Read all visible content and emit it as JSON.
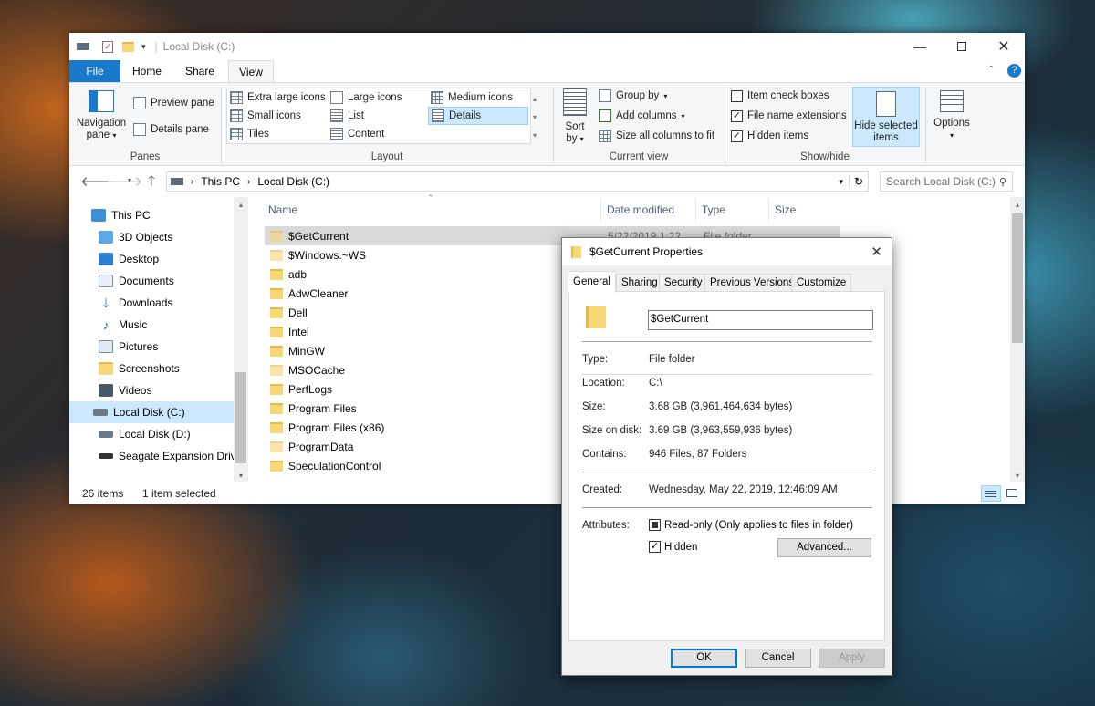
{
  "explorer": {
    "title": "Local Disk (C:)",
    "tabs": {
      "file": "File",
      "home": "Home",
      "share": "Share",
      "view": "View"
    },
    "ribbon": {
      "panes": {
        "navigation_pane": "Navigation",
        "navigation_pane_2": "pane",
        "preview_pane": "Preview pane",
        "details_pane": "Details pane",
        "label": "Panes"
      },
      "layout": {
        "extra_large_icons": "Extra large icons",
        "large_icons": "Large icons",
        "medium_icons": "Medium icons",
        "small_icons": "Small icons",
        "list": "List",
        "details": "Details",
        "tiles": "Tiles",
        "content": "Content",
        "label": "Layout"
      },
      "current_view": {
        "sort_by": "Sort",
        "sort_by_2": "by",
        "group_by": "Group by",
        "add_columns": "Add columns",
        "size_all_columns": "Size all columns to fit",
        "label": "Current view"
      },
      "show_hide": {
        "item_check_boxes": "Item check boxes",
        "file_name_extensions": "File name extensions",
        "hidden_items": "Hidden items",
        "hide_selected_items": "Hide selected",
        "hide_selected_items_2": "items",
        "label": "Show/hide"
      },
      "options": "Options"
    },
    "address": {
      "this_pc": "This PC",
      "drive": "Local Disk (C:)"
    },
    "search_placeholder": "Search Local Disk (C:)",
    "nav_items": [
      "This PC",
      "3D Objects",
      "Desktop",
      "Documents",
      "Downloads",
      "Music",
      "Pictures",
      "Screenshots",
      "Videos",
      "Local Disk (C:)",
      "Local Disk (D:)",
      "Seagate Expansion Drive"
    ],
    "columns": {
      "name": "Name",
      "date_modified": "Date modified",
      "type": "Type",
      "size": "Size"
    },
    "selected_row": {
      "date": "5/22/2019 1:22",
      "type": "File folder"
    },
    "files": [
      "$GetCurrent",
      "$Windows.~WS",
      "adb",
      "AdwCleaner",
      "Dell",
      "Intel",
      "MinGW",
      "MSOCache",
      "PerfLogs",
      "Program Files",
      "Program Files (x86)",
      "ProgramData",
      "SpeculationControl"
    ],
    "status": {
      "items": "26 items",
      "selected": "1 item selected"
    }
  },
  "properties": {
    "title": "$GetCurrent Properties",
    "tabs": {
      "general": "General",
      "sharing": "Sharing",
      "security": "Security",
      "previous_versions": "Previous Versions",
      "customize": "Customize"
    },
    "name_value": "$GetCurrent",
    "fields": {
      "type_label": "Type:",
      "type_value": "File folder",
      "location_label": "Location:",
      "location_value": "C:\\",
      "size_label": "Size:",
      "size_value": "3.68 GB (3,961,464,634 bytes)",
      "size_on_disk_label": "Size on disk:",
      "size_on_disk_value": "3.69 GB (3,963,559,936 bytes)",
      "contains_label": "Contains:",
      "contains_value": "946 Files, 87 Folders",
      "created_label": "Created:",
      "created_value": "Wednesday, May 22, 2019, 12:46:09 AM",
      "attributes_label": "Attributes:",
      "readonly_label": "Read-only (Only applies to files in folder)",
      "hidden_label": "Hidden"
    },
    "buttons": {
      "advanced": "Advanced...",
      "ok": "OK",
      "cancel": "Cancel",
      "apply": "Apply"
    }
  },
  "colors": {
    "accent": "#0078d7",
    "file_tab": "#1979ca",
    "selection": "#cce8ff",
    "folder": "#f8d775"
  }
}
